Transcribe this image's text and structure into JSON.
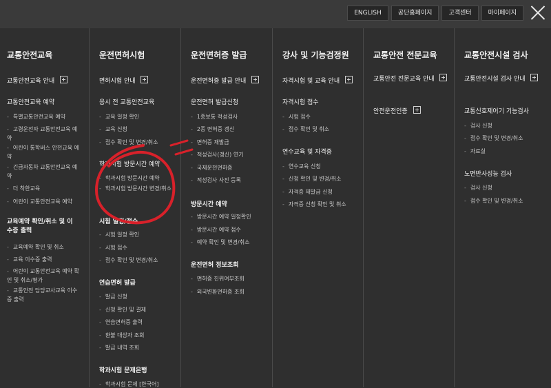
{
  "top_links": [
    "ENGLISH",
    "공단홈페이지",
    "고객센터",
    "마이페이지"
  ],
  "columns": [
    {
      "title": "교통안전교육",
      "blocks": [
        {
          "label": "교통안전교육 안내",
          "kind": "heading-plus"
        },
        {
          "label": "교통안전교육 예약",
          "kind": "section"
        },
        {
          "label": "특별교통안전교육 예약",
          "kind": "sub"
        },
        {
          "label": "고령운전자 교통안전교육 예약",
          "kind": "sub"
        },
        {
          "label": "어린이 통학버스 안전교육 예약",
          "kind": "sub"
        },
        {
          "label": "긴급자동차 교통안전교육 예약",
          "kind": "sub"
        },
        {
          "label": "더 착한교육",
          "kind": "sub"
        },
        {
          "label": "어린이 교통안전교육 예약",
          "kind": "sub"
        },
        {
          "label": "교육예약 확인/취소 및 이수증 출력",
          "kind": "section-bold"
        },
        {
          "label": "교육예약 확인 및 취소",
          "kind": "sub"
        },
        {
          "label": "교육 이수증 출력",
          "kind": "sub"
        },
        {
          "label": "어린이 교통안전교육 예약 확인 및 취소/평가",
          "kind": "sub"
        },
        {
          "label": "교통안전 담당교사교육 이수증 출력",
          "kind": "sub"
        }
      ]
    },
    {
      "title": "운전면허시험",
      "blocks": [
        {
          "label": "면허시험 안내",
          "kind": "heading-plus"
        },
        {
          "label": "응시 전 교통안전교육",
          "kind": "section"
        },
        {
          "label": "교육 일정 확인",
          "kind": "sub"
        },
        {
          "label": "교육 신청",
          "kind": "sub"
        },
        {
          "label": "접수 확인 및 변경/취소",
          "kind": "sub"
        },
        {
          "label": "학과시험 방문시간 예약",
          "kind": "section"
        },
        {
          "label": "학과시험 방문시간 예약",
          "kind": "sub"
        },
        {
          "label": "학과시험 방문시간 변경/취소",
          "kind": "sub"
        },
        {
          "label": "시험 일정/접수",
          "kind": "section-bold"
        },
        {
          "label": "시험 일정 확인",
          "kind": "sub"
        },
        {
          "label": "시험 접수",
          "kind": "sub"
        },
        {
          "label": "접수 확인 및 변경/취소",
          "kind": "sub"
        },
        {
          "label": "연습면허 발급",
          "kind": "section-bold"
        },
        {
          "label": "발급 신청",
          "kind": "sub"
        },
        {
          "label": "신청 확인 및 결제",
          "kind": "sub"
        },
        {
          "label": "연습면허증 출력",
          "kind": "sub"
        },
        {
          "label": "환불 대상자 조회",
          "kind": "sub"
        },
        {
          "label": "발급 내역 조회",
          "kind": "sub"
        },
        {
          "label": "학과시험 문제은행",
          "kind": "section-bold"
        },
        {
          "label": "학과시험 문제 [한국어]",
          "kind": "sub"
        }
      ]
    },
    {
      "title": "운전면허증 발급",
      "blocks": [
        {
          "label": "운전면허증 발급 안내",
          "kind": "heading-plus"
        },
        {
          "label": "운전면허 발급신청",
          "kind": "section"
        },
        {
          "label": "1종보통 적성검사",
          "kind": "sub"
        },
        {
          "label": "2종 면허증 갱신",
          "kind": "sub"
        },
        {
          "label": "면허증 재발급",
          "kind": "sub"
        },
        {
          "label": "적성검사(갱신) 연기",
          "kind": "sub"
        },
        {
          "label": "국제운전면허증",
          "kind": "sub"
        },
        {
          "label": "적성검사 사진 등록",
          "kind": "sub"
        },
        {
          "label": "방문시간 예약",
          "kind": "section-bold"
        },
        {
          "label": "방문시간 예약 일정확인",
          "kind": "sub"
        },
        {
          "label": "방문시간 예약 접수",
          "kind": "sub"
        },
        {
          "label": "예약 확인 및 변경/취소",
          "kind": "sub"
        },
        {
          "label": "운전면허 정보조회",
          "kind": "section-bold"
        },
        {
          "label": "면허증 진위여부조회",
          "kind": "sub"
        },
        {
          "label": "외국변환면허증 조회",
          "kind": "sub"
        }
      ]
    },
    {
      "title": "강사 및 기능검정원",
      "blocks": [
        {
          "label": "자격시험 및 교육 안내",
          "kind": "heading-plus"
        },
        {
          "label": "자격시험 접수",
          "kind": "section"
        },
        {
          "label": "시험 접수",
          "kind": "sub"
        },
        {
          "label": "접수 확인 및 취소",
          "kind": "sub"
        },
        {
          "label": "연수교육 및 자격증",
          "kind": "section"
        },
        {
          "label": "연수교육 신청",
          "kind": "sub"
        },
        {
          "label": "신청 확인 및 변경/취소",
          "kind": "sub"
        },
        {
          "label": "자격증 재발급 신청",
          "kind": "sub"
        },
        {
          "label": "자격증 신청 확인 및 취소",
          "kind": "sub"
        }
      ]
    },
    {
      "title": "교통안전 전문교육",
      "blocks": [
        {
          "label": "교통안전 전문교육 안내",
          "kind": "heading-plus"
        },
        {
          "label": "안전운전인증",
          "kind": "heading-plus"
        }
      ]
    },
    {
      "title": "교통안전시설 검사",
      "blocks": [
        {
          "label": "교통안전시설 검사 안내",
          "kind": "heading-plus"
        },
        {
          "label": "교통신호제어기 기능검사",
          "kind": "section"
        },
        {
          "label": "검사 신청",
          "kind": "sub"
        },
        {
          "label": "접수 확인 및 변경/취소",
          "kind": "sub"
        },
        {
          "label": "자료실",
          "kind": "sub"
        },
        {
          "label": "노면반사성능 검사",
          "kind": "section"
        },
        {
          "label": "검사 신청",
          "kind": "sub"
        },
        {
          "label": "접수 확인 및 변경/취소",
          "kind": "sub"
        }
      ]
    }
  ]
}
